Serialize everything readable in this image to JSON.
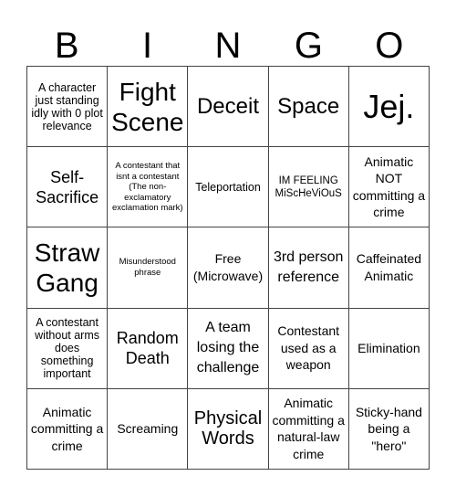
{
  "header": {
    "letters": [
      "B",
      "I",
      "N",
      "G",
      "O"
    ]
  },
  "cells": [
    "A character just standing idly with 0 plot relevance",
    "Fight Scene",
    "Deceit",
    "Space",
    "Jej.",
    "Self-Sacrifice",
    "A contestant that isnt a contestant (The non-exclamatory exclamation mark)",
    "Teleportation",
    "IM FEELING MiScHeViOuS",
    "Animatic NOT committing a crime",
    "Straw Gang",
    "Misunderstood phrase",
    "Free (Microwave)",
    "3rd person reference",
    "Caffeinated Animatic",
    "A contestant without arms does something important",
    "Random Death",
    "A team losing the challenge",
    "Contestant used as a weapon",
    "Elimination",
    "Animatic committing a crime",
    "Screaming",
    "Physical Words",
    "Animatic committing a natural-law crime",
    "Sticky-hand being a \"hero\""
  ]
}
